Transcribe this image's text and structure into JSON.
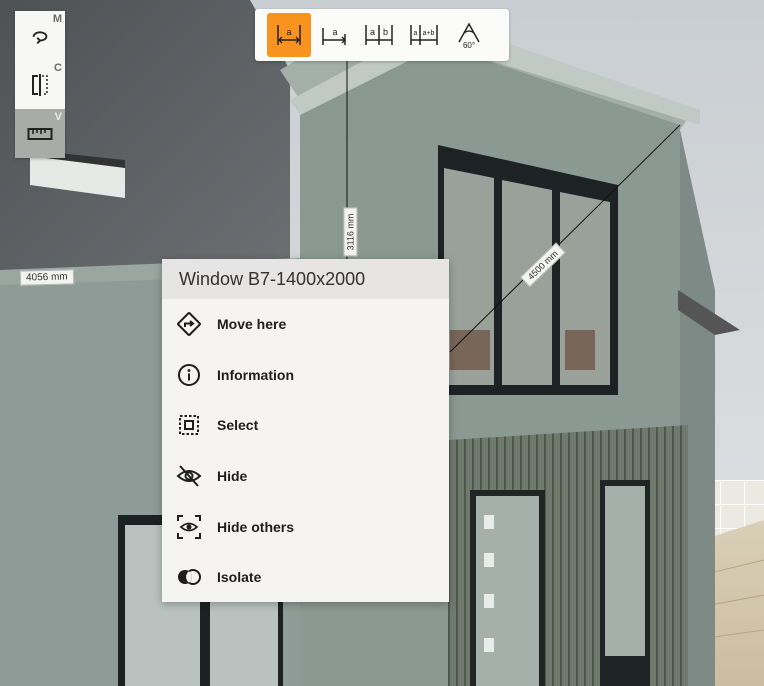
{
  "left_toolbar": {
    "tools": [
      {
        "name": "orbit",
        "key": "M",
        "icon": "orbit-icon"
      },
      {
        "name": "clip",
        "key": "C",
        "icon": "section-clip-icon"
      },
      {
        "name": "measure",
        "key": "V",
        "icon": "ruler-icon",
        "active": true
      }
    ]
  },
  "measure_toolbar": {
    "tools": [
      {
        "name": "point-to-point",
        "icon": "measure-point-icon",
        "label": "a",
        "active": true
      },
      {
        "name": "height",
        "icon": "measure-height-icon",
        "label": "a"
      },
      {
        "name": "chained",
        "icon": "measure-chain-icon",
        "label_a": "a",
        "label_b": "b"
      },
      {
        "name": "cumulative",
        "icon": "measure-cumulative-icon",
        "label_a": "a",
        "label_b": "a+b"
      },
      {
        "name": "angle",
        "icon": "measure-angle-icon",
        "label": "60°"
      }
    ]
  },
  "dimensions": [
    {
      "name": "dimension-roof-width",
      "text": "4056 mm"
    },
    {
      "name": "dimension-vertical",
      "text": "3116 mm"
    },
    {
      "name": "dimension-diagonal",
      "text": "4500 mm"
    }
  ],
  "context_menu": {
    "title": "Window B7-1400x2000",
    "items": [
      {
        "name": "move-here",
        "label": "Move here",
        "icon": "move-arrow-icon"
      },
      {
        "name": "information",
        "label": "Information",
        "icon": "info-icon"
      },
      {
        "name": "select",
        "label": "Select",
        "icon": "select-icon"
      },
      {
        "name": "hide",
        "label": "Hide",
        "icon": "eye-slash-icon"
      },
      {
        "name": "hide-others",
        "label": "Hide others",
        "icon": "eye-focus-icon"
      },
      {
        "name": "isolate",
        "label": "Isolate",
        "icon": "isolate-icon"
      }
    ]
  },
  "colors": {
    "accent": "#f7931e",
    "menu_bg": "#f5f4f2",
    "menu_title_bg": "#e6e5e3",
    "wall": "#8d9c96",
    "roof": "#5d6063"
  }
}
